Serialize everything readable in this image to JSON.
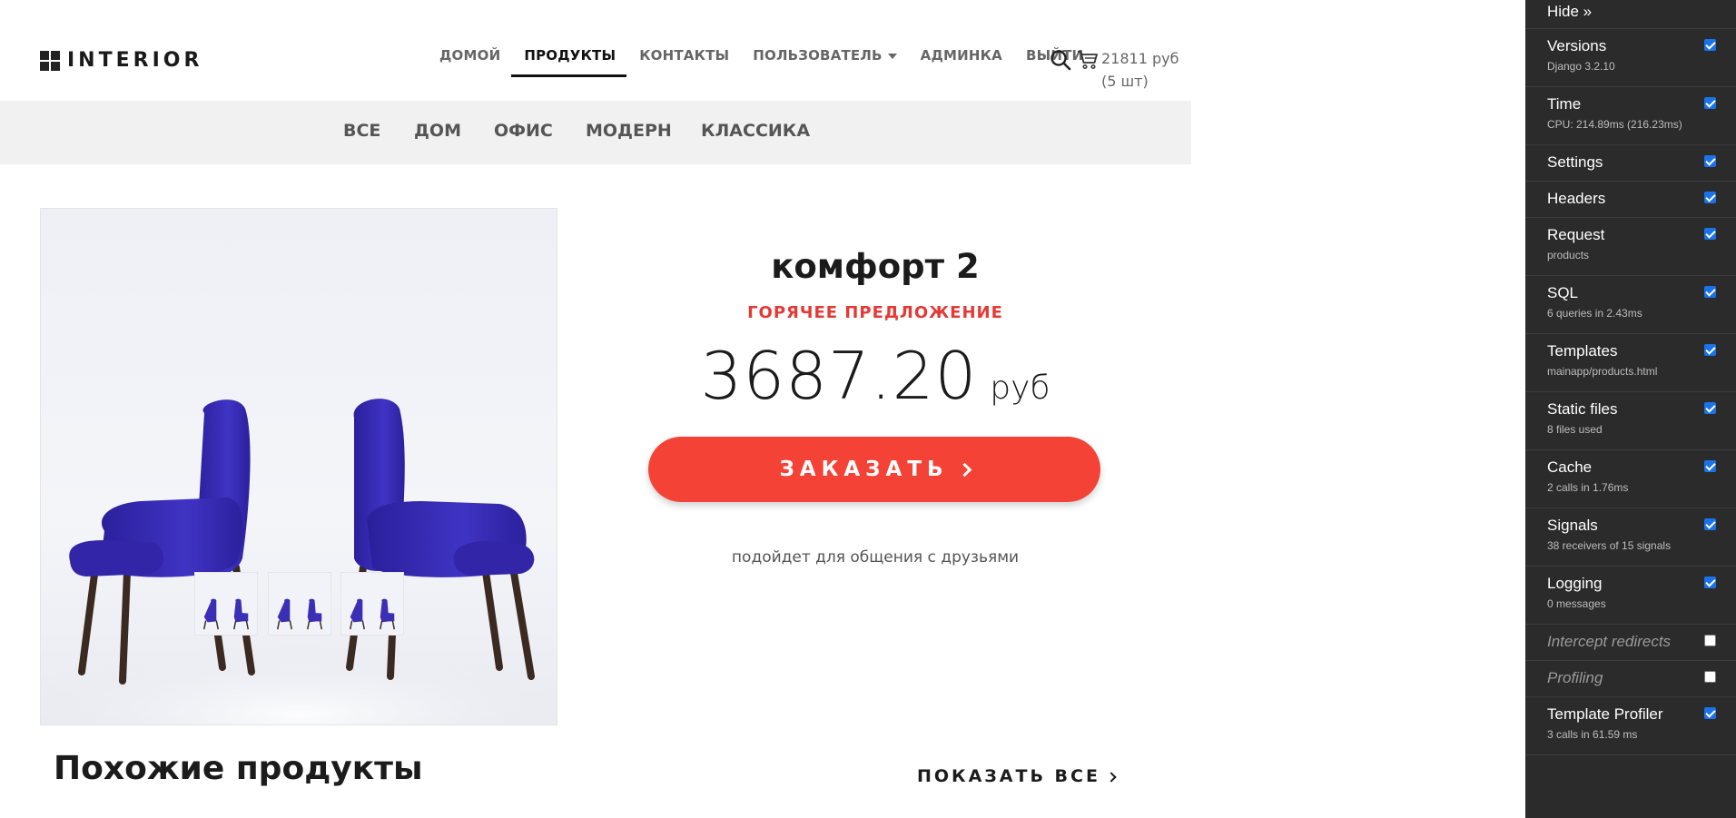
{
  "header": {
    "logo_text": "INTERIOR",
    "nav": [
      {
        "label": "ДОМОЙ"
      },
      {
        "label": "ПРОДУКТЫ"
      },
      {
        "label": "КОНТАКТЫ"
      },
      {
        "label": "ПОЛЬЗОВАТЕЛЬ"
      },
      {
        "label": "АДМИНКА"
      },
      {
        "label": "ВЫЙТИ"
      }
    ],
    "cart_total": "21811 руб",
    "cart_count": "(5 шт)"
  },
  "categories": [
    "ВСЕ",
    "ДОМ",
    "ОФИС",
    "МОДЕРН",
    "КЛАССИКА"
  ],
  "product": {
    "title": "комфорт 2",
    "badge": "ГОРЯЧЕЕ ПРЕДЛОЖЕНИЕ",
    "price": "3687.20",
    "currency": "руб",
    "order_label": "ЗАКАЗАТЬ",
    "description": "подойдет для общения с друзьями",
    "thumbnail_count": 3
  },
  "similar": {
    "title": "Похожие продукты",
    "show_all": "ПОКАЗАТЬ ВСЕ"
  },
  "colors": {
    "accent": "#f44336",
    "hot": "#e53935",
    "chair": "#3b2fb5",
    "toolbar_bg": "#2b2b2b",
    "checkbox": "#1a73e8"
  },
  "debug_toolbar": {
    "hide_label": "Hide »",
    "panels": [
      {
        "title": "Versions",
        "subtitle": "Django 3.2.10",
        "enabled": true
      },
      {
        "title": "Time",
        "subtitle": "CPU: 214.89ms (216.23ms)",
        "enabled": true
      },
      {
        "title": "Settings",
        "subtitle": "",
        "enabled": true
      },
      {
        "title": "Headers",
        "subtitle": "",
        "enabled": true
      },
      {
        "title": "Request",
        "subtitle": "products",
        "enabled": true
      },
      {
        "title": "SQL",
        "subtitle": "6 queries in 2.43ms",
        "enabled": true
      },
      {
        "title": "Templates",
        "subtitle": "mainapp/products.html",
        "enabled": true
      },
      {
        "title": "Static files",
        "subtitle": "8 files used",
        "enabled": true
      },
      {
        "title": "Cache",
        "subtitle": "2 calls in 1.76ms",
        "enabled": true
      },
      {
        "title": "Signals",
        "subtitle": "38 receivers of 15 signals",
        "enabled": true
      },
      {
        "title": "Logging",
        "subtitle": "0 messages",
        "enabled": true
      },
      {
        "title": "Intercept redirects",
        "subtitle": "",
        "enabled": false
      },
      {
        "title": "Profiling",
        "subtitle": "",
        "enabled": false
      },
      {
        "title": "Template Profiler",
        "subtitle": "3 calls in 61.59 ms",
        "enabled": true
      }
    ]
  }
}
